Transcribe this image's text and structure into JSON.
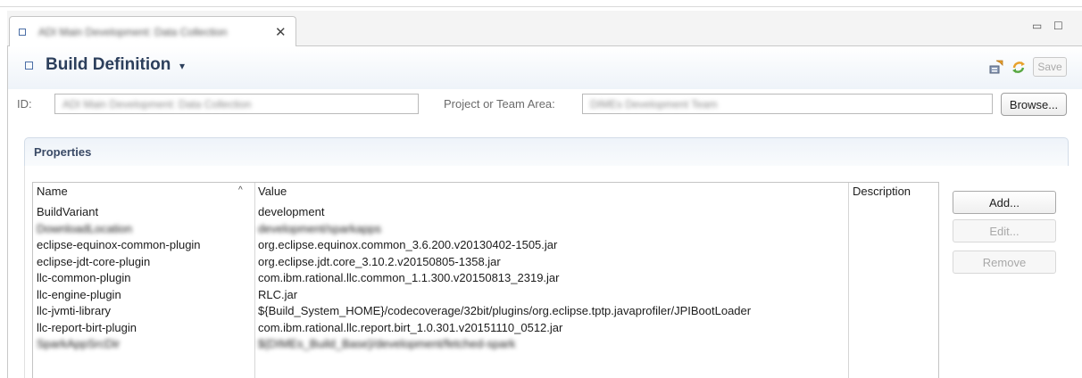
{
  "tab": {
    "title": "ADI Main Development: Data Collection",
    "close_glyph": "✕",
    "minimize_glyph": "▭",
    "maximize_glyph": "☐"
  },
  "header": {
    "title": "Build Definition",
    "caret": "▾",
    "save_label": "Save"
  },
  "fields": {
    "id_label": "ID:",
    "id_value": "ADI Main Development: Data Collection",
    "project_label": "Project or Team Area:",
    "project_value": "DIMEs Development Team",
    "browse_label": "Browse..."
  },
  "properties": {
    "section_title": "Properties",
    "columns": {
      "name": "Name",
      "value": "Value",
      "description": "Description"
    },
    "sort_glyph": "^",
    "rows": [
      {
        "name": "BuildVariant",
        "value": "development",
        "blurred": false
      },
      {
        "name": "DownloadLocation",
        "value": "development/sparkapps",
        "blurred": true
      },
      {
        "name": "eclipse-equinox-common-plugin",
        "value": "org.eclipse.equinox.common_3.6.200.v20130402-1505.jar",
        "blurred": false
      },
      {
        "name": "eclipse-jdt-core-plugin",
        "value": "org.eclipse.jdt.core_3.10.2.v20150805-1358.jar",
        "blurred": false
      },
      {
        "name": "llc-common-plugin",
        "value": "com.ibm.rational.llc.common_1.1.300.v20150813_2319.jar",
        "blurred": false
      },
      {
        "name": "llc-engine-plugin",
        "value": "RLC.jar",
        "blurred": false
      },
      {
        "name": "llc-jvmti-library",
        "value": "${Build_System_HOME}/codecoverage/32bit/plugins/org.eclipse.tptp.javaprofiler/JPIBootLoader",
        "blurred": false
      },
      {
        "name": "llc-report-birt-plugin",
        "value": "com.ibm.rational.llc.report.birt_1.0.301.v20151110_0512.jar",
        "blurred": false
      },
      {
        "name": "SparkAppSrcDir",
        "value": "${DIMEs_Build_Base}/development/fetched-spark",
        "blurred": true
      }
    ],
    "buttons": {
      "add": "Add...",
      "edit": "Edit...",
      "remove": "Remove"
    }
  },
  "colors": {
    "accent_title": "#2c3f5c",
    "icon_blue": "#4b6ea6",
    "section_bg": "#eef3f9"
  },
  "icons": {
    "tab_icon": "editor-icon",
    "toolbar_1": "build-request-icon",
    "toolbar_2": "refresh-icon"
  }
}
